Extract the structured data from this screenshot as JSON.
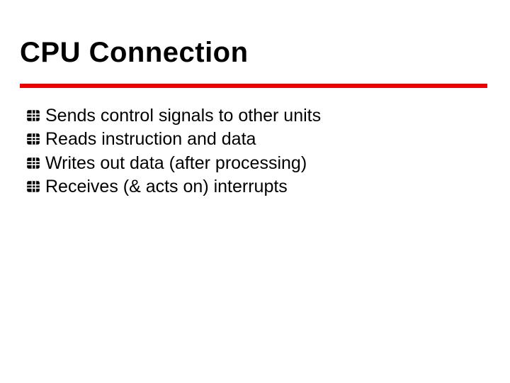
{
  "title": "CPU Connection",
  "divider_color": "#ef0000",
  "bullets": {
    "b0": "Sends control signals to other units",
    "b1": "Reads instruction and data",
    "b2": "Writes out data (after processing)",
    "b3": "Receives (& acts on) interrupts"
  }
}
